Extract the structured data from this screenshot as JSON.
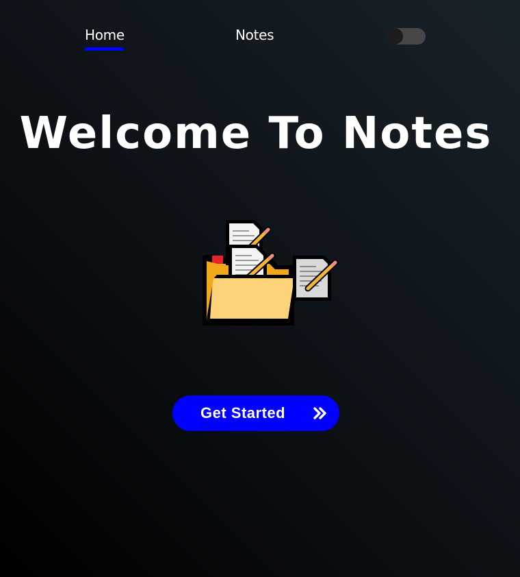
{
  "nav": {
    "items": [
      {
        "label": "Home",
        "active": true
      },
      {
        "label": "Notes",
        "active": false
      }
    ],
    "active_indicator_color": "#0000ff"
  },
  "theme_toggle": {
    "icon": "moon-icon",
    "icon_color": "#ffd400",
    "track_color": "#474747",
    "state": "dark"
  },
  "hero": {
    "title": "Welcome To Notes",
    "illustration": "notes-folder-icon"
  },
  "cta": {
    "label": "Get Started",
    "icon": "double-chevron-right-icon",
    "color": "#0000ff"
  }
}
